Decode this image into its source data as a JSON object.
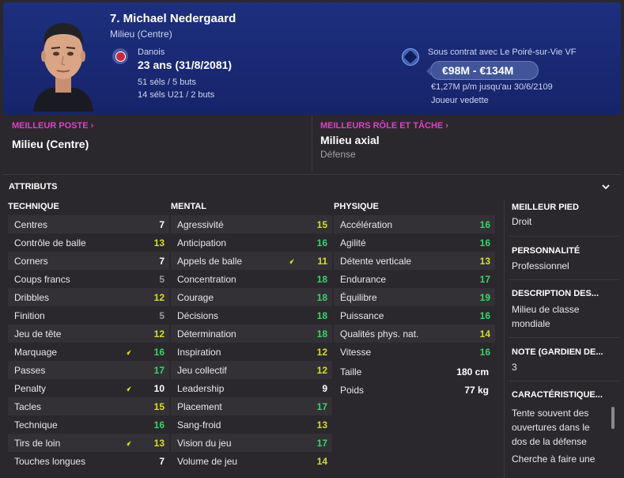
{
  "header": {
    "name": "7. Michael Nedergaard",
    "position": "Milieu (Centre)",
    "nationality": "Danois",
    "age": "23 ans (31/8/2081)",
    "caps": "51 séls / 5 buts",
    "caps_u21": "14 séls U21 / 2 buts",
    "contract": "Sous contrat avec Le Poiré-sur-Vie VF",
    "value": "€98M - €134M",
    "wage": "€1,27M p/m jusqu'au 30/6/2109",
    "status": "Joueur vedette"
  },
  "best_position": {
    "label": "MEILLEUR POSTE",
    "value": "Milieu (Centre)"
  },
  "best_role": {
    "label": "MEILLEURS RÔLE ET TÂCHE",
    "value": "Milieu axial",
    "duty": "Défense"
  },
  "attributes": {
    "title": "ATTRIBUTS",
    "technique": {
      "header": "TECHNIQUE",
      "rows": [
        {
          "name": "Centres",
          "value": "7"
        },
        {
          "name": "Contrôle de balle",
          "value": "13"
        },
        {
          "name": "Corners",
          "value": "7"
        },
        {
          "name": "Coups francs",
          "value": "5"
        },
        {
          "name": "Dribbles",
          "value": "12"
        },
        {
          "name": "Finition",
          "value": "5"
        },
        {
          "name": "Jeu de tête",
          "value": "12"
        },
        {
          "name": "Marquage",
          "value": "16"
        },
        {
          "name": "Passes",
          "value": "17"
        },
        {
          "name": "Penalty",
          "value": "10"
        },
        {
          "name": "Tacles",
          "value": "15"
        },
        {
          "name": "Technique",
          "value": "16"
        },
        {
          "name": "Tirs de loin",
          "value": "13"
        },
        {
          "name": "Touches longues",
          "value": "7"
        }
      ]
    },
    "mental": {
      "header": "MENTAL",
      "rows": [
        {
          "name": "Agressivité",
          "value": "15"
        },
        {
          "name": "Anticipation",
          "value": "16"
        },
        {
          "name": "Appels de balle",
          "value": "11"
        },
        {
          "name": "Concentration",
          "value": "18"
        },
        {
          "name": "Courage",
          "value": "18"
        },
        {
          "name": "Décisions",
          "value": "18"
        },
        {
          "name": "Détermination",
          "value": "18"
        },
        {
          "name": "Inspiration",
          "value": "12"
        },
        {
          "name": "Jeu collectif",
          "value": "12"
        },
        {
          "name": "Leadership",
          "value": "9"
        },
        {
          "name": "Placement",
          "value": "17"
        },
        {
          "name": "Sang-froid",
          "value": "13"
        },
        {
          "name": "Vision du jeu",
          "value": "17"
        },
        {
          "name": "Volume de jeu",
          "value": "14"
        }
      ]
    },
    "physique": {
      "header": "PHYSIQUE",
      "rows": [
        {
          "name": "Accélération",
          "value": "16"
        },
        {
          "name": "Agilité",
          "value": "16"
        },
        {
          "name": "Détente verticale",
          "value": "13"
        },
        {
          "name": "Endurance",
          "value": "17"
        },
        {
          "name": "Équilibre",
          "value": "19"
        },
        {
          "name": "Puissance",
          "value": "16"
        },
        {
          "name": "Qualités phys. nat.",
          "value": "14"
        },
        {
          "name": "Vitesse",
          "value": "16"
        }
      ],
      "height_label": "Taille",
      "height_value": "180 cm",
      "weight_label": "Poids",
      "weight_value": "77 kg"
    }
  },
  "side": {
    "foot_title": "MEILLEUR PIED",
    "foot_value": "Droit",
    "personality_title": "PERSONNALITÉ",
    "personality_value": "Professionnel",
    "description_title": "DESCRIPTION DES...",
    "description_value": "Milieu de classe mondiale",
    "gk_title": "NOTE (GARDIEN DE...",
    "gk_value": "3",
    "traits_title": "CARACTÉRISTIQUE...",
    "trait_1": "Tente souvent des ouvertures dans le dos de la défense",
    "trait_2": "Cherche à faire une"
  },
  "colors": {
    "header_bg": "#1d2f7e",
    "accent_pink": "#e040c8",
    "value_white": "#ffffff",
    "value_grey": "#9a989e",
    "value_yellow": "#d8dc2c",
    "value_green": "#3ad46a",
    "value_bright_green": "#2ee05c"
  }
}
